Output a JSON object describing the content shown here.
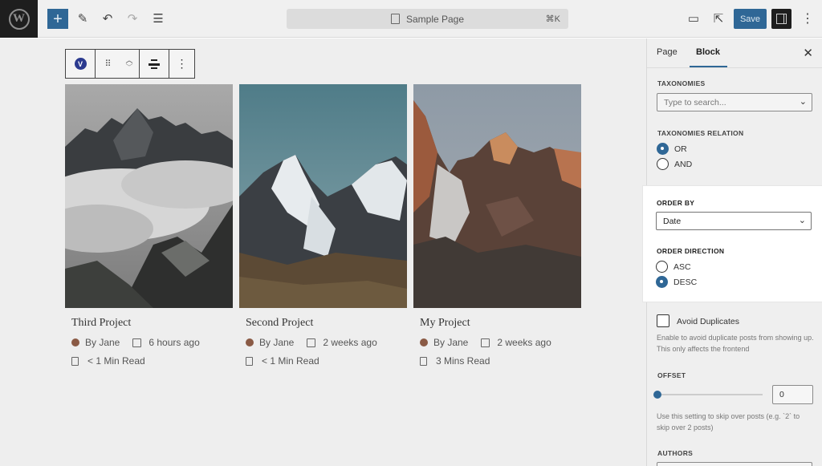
{
  "topbar": {
    "document_title": "Sample Page",
    "shortcut": "⌘K",
    "save_label": "Save"
  },
  "block_toolbar": {
    "badge_letter": "V"
  },
  "cards": [
    {
      "title": "Third Project",
      "author": "By Jane",
      "date": "6 hours ago",
      "read_time": "< 1 Min Read"
    },
    {
      "title": "Second Project",
      "author": "By Jane",
      "date": "2 weeks ago",
      "read_time": "< 1 Min Read"
    },
    {
      "title": "My Project",
      "author": "By Jane",
      "date": "2 weeks ago",
      "read_time": "3 Mins Read"
    }
  ],
  "sidebar": {
    "tabs": [
      "Page",
      "Block"
    ],
    "active_tab": "Block",
    "taxonomies": {
      "label": "TAXONOMIES",
      "placeholder": "Type to search..."
    },
    "taxonomies_relation": {
      "label": "TAXONOMIES RELATION",
      "options": [
        "OR",
        "AND"
      ],
      "selected": "OR"
    },
    "order_by": {
      "label": "ORDER BY",
      "value": "Date"
    },
    "order_direction": {
      "label": "ORDER DIRECTION",
      "options": [
        "ASC",
        "DESC"
      ],
      "selected": "DESC"
    },
    "avoid_duplicates": {
      "label": "Avoid Duplicates",
      "checked": false,
      "help": "Enable to avoid duplicate posts from showing up. This only affects the frontend"
    },
    "offset": {
      "label": "OFFSET",
      "value": "0",
      "help": "Use this setting to skip over posts (e.g. `2` to skip over 2 posts)"
    },
    "authors": {
      "label": "AUTHORS"
    }
  },
  "colors": {
    "accent": "#2f6796",
    "canvas": "#eeeeee",
    "sidebar": "#efefef"
  }
}
